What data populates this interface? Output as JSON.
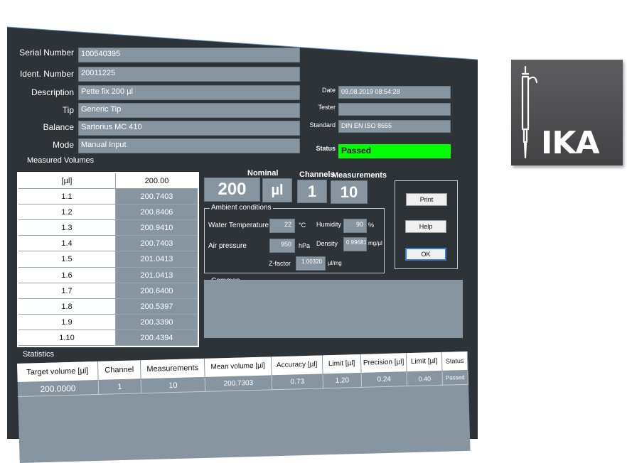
{
  "window": {
    "close_glyph": "×"
  },
  "fields": {
    "serial_label": "Serial Number",
    "serial_value": "100540395",
    "ident_label": "Ident. Number",
    "ident_value": "20011225",
    "desc_label": "Description",
    "desc_value": "Pette fix 200 µl",
    "tip_label": "Tip",
    "tip_value": "Generic Tip",
    "balance_label": "Balance",
    "balance_value": "Sartorius MC 410",
    "mode_label": "Mode",
    "mode_value": "Manual Input"
  },
  "right_fields": {
    "date_label": "Date",
    "date_value": "09.08.2019 08:54:28",
    "tester_label": "Tester",
    "tester_value": "",
    "standard_label": "Standard",
    "standard_value": "DIN EN ISO 8655",
    "status_label": "Status",
    "status_value": "Passed"
  },
  "measured": {
    "title": "Measured Volumes",
    "header": [
      "[µl]",
      "200.00"
    ],
    "rows": [
      [
        "1.1",
        "200.7403"
      ],
      [
        "1.2",
        "200.8406"
      ],
      [
        "1.3",
        "200.9410"
      ],
      [
        "1.4",
        "200.7403"
      ],
      [
        "1.5",
        "201.0413"
      ],
      [
        "1.6",
        "201.0413"
      ],
      [
        "1.7",
        "200.6400"
      ],
      [
        "1.8",
        "200.5397"
      ],
      [
        "1.9",
        "200.3390"
      ],
      [
        "1.10",
        "200.4394"
      ]
    ]
  },
  "summary": {
    "nominal_label": "Nominal",
    "nominal_value": "200",
    "nominal_unit": "µl",
    "channels_label": "Channels",
    "channels_value": "1",
    "measurements_label": "Measurements",
    "measurements_value": "10"
  },
  "ambient": {
    "title": "Ambient conditions",
    "water_temp_label": "Water Temperature",
    "water_temp_value": "22",
    "water_temp_unit": "°C",
    "humidity_label": "Humidity",
    "humidity_value": "90",
    "humidity_unit": "%",
    "air_pressure_label": "Air pressure",
    "air_pressure_value": "950",
    "air_pressure_unit": "hPa",
    "density_label": "Density",
    "density_value": "0.99681",
    "density_unit": "mg/µl",
    "zfactor_label": "Z-factor",
    "zfactor_value": "1.00320",
    "zfactor_unit": "µl/mg"
  },
  "buttons": {
    "print": "Print",
    "help": "Help",
    "ok": "OK"
  },
  "comment": {
    "label": "Commen"
  },
  "statistics": {
    "title": "Statistics",
    "headers": [
      "Target volume [µl]",
      "Channel",
      "Measurements",
      "Mean volume [µl]",
      "Accuracy  [µl]",
      "Limit [µl]",
      "Precision [µl]",
      "Limit [µl]",
      "Status"
    ],
    "values": [
      "200.0000",
      "1",
      "10",
      "200.7303",
      "0.73",
      "1.20",
      "0.24",
      "0.40",
      "Passed"
    ]
  },
  "logo": {
    "text": "IKA"
  },
  "colors": {
    "window_bg": "#2e3338",
    "field_bg": "#8795a0",
    "status_ok": "#00ff00"
  }
}
